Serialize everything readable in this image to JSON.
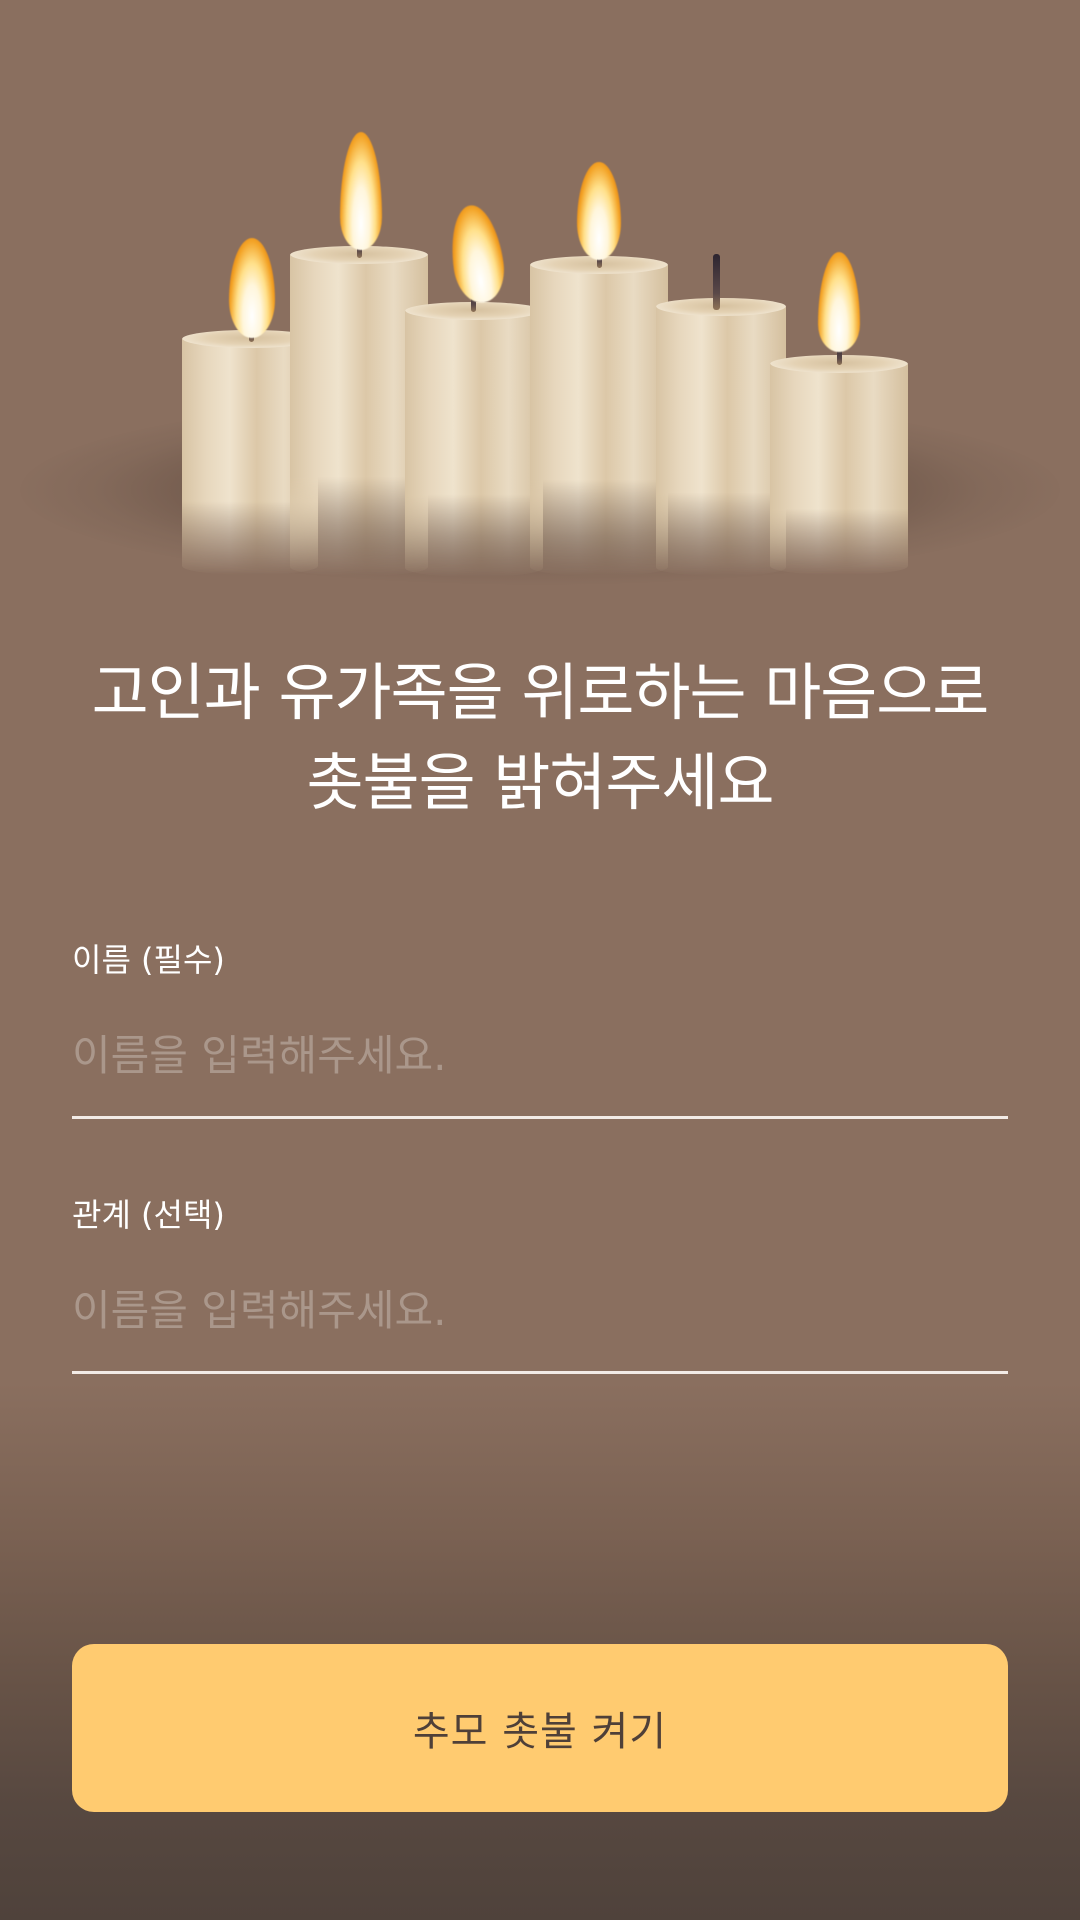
{
  "heading": {
    "line1": "고인과 유가족을 위로하는 마음으로",
    "line2": "촛불을 밝혀주세요"
  },
  "form": {
    "name": {
      "label": "이름 (필수)",
      "placeholder": "이름을 입력해주세요.",
      "value": ""
    },
    "relation": {
      "label": "관계 (선택)",
      "placeholder": "이름을 입력해주세요.",
      "value": ""
    }
  },
  "actions": {
    "submit_label": "추모 촛불 켜기"
  },
  "colors": {
    "background": "#8a6f5f",
    "button": "#ffcb70",
    "button_text": "#4f4038"
  },
  "icons": {
    "illustration": "memorial-candles-illustration"
  }
}
